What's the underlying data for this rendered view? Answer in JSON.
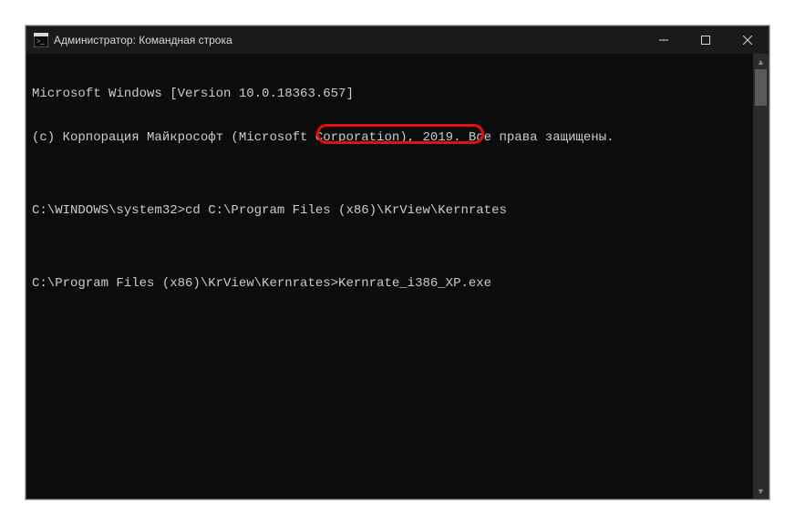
{
  "window": {
    "title": "Администратор: Командная строка"
  },
  "terminal": {
    "lines": [
      "Microsoft Windows [Version 10.0.18363.657]",
      "(c) Корпорация Майкрософт (Microsoft Corporation), 2019. Все права защищены.",
      "",
      "C:\\WINDOWS\\system32>cd C:\\Program Files (x86)\\KrView\\Kernrates",
      "",
      "C:\\Program Files (x86)\\KrView\\Kernrates>Kernrate_i386_XP.exe"
    ]
  },
  "highlight": {
    "text": "Kernrate_i386_XP.exe"
  },
  "colors": {
    "terminal_bg": "#0c0c0c",
    "terminal_fg": "#cccccc",
    "titlebar_bg": "#1a1a1a",
    "highlight_border": "#e10f0f"
  }
}
